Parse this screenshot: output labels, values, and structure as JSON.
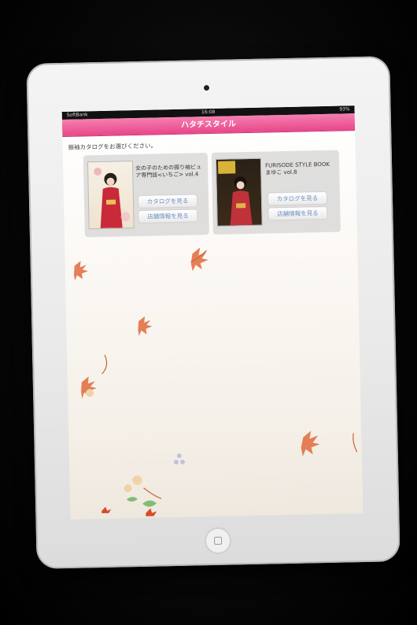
{
  "status_bar": {
    "carrier": "SoftBank",
    "time": "16:08",
    "battery": "93%"
  },
  "nav": {
    "title": "ハタチスタイル"
  },
  "main": {
    "prompt": "振袖カタログをお選びください。",
    "catalogs": [
      {
        "title": "女の子のための振り袖ビュア専門誌<いちご> vol.4",
        "view_label": "カタログを見る",
        "store_label": "店舗情報を見る"
      },
      {
        "title": "FURISODE STYLE BOOK まゆこ vol.8",
        "view_label": "カタログを見る",
        "store_label": "店舗情報を見る"
      }
    ]
  },
  "colors": {
    "nav_pink": "#e8468a",
    "button_text": "#6a8fbf",
    "leaf_red": "#d94a2a",
    "leaf_orange": "#e89a3a"
  }
}
